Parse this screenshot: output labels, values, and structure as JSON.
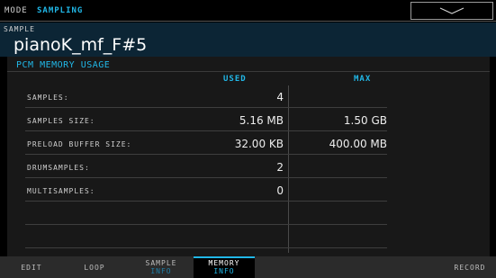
{
  "mode": {
    "label": "MODE",
    "value": "SAMPLING"
  },
  "sample": {
    "caption": "SAMPLE",
    "name": "pianoK_mf_F#5"
  },
  "panel": {
    "title": "PCM MEMORY USAGE",
    "headers": {
      "used": "USED",
      "max": "MAX"
    },
    "rows": [
      {
        "label": "SAMPLES:",
        "used": "4",
        "max": ""
      },
      {
        "label": "SAMPLES SIZE:",
        "used": "5.16 MB",
        "max": "1.50 GB"
      },
      {
        "label": "PRELOAD BUFFER SIZE:",
        "used": "32.00 KB",
        "max": "400.00 MB"
      },
      {
        "label": "DRUMSAMPLES:",
        "used": "2",
        "max": ""
      },
      {
        "label": "MULTISAMPLES:",
        "used": "0",
        "max": ""
      },
      {
        "label": "",
        "used": "",
        "max": ""
      },
      {
        "label": "",
        "used": "",
        "max": ""
      }
    ]
  },
  "tabs": [
    {
      "line1": "EDIT",
      "line2": ""
    },
    {
      "line1": "LOOP",
      "line2": ""
    },
    {
      "line1": "SAMPLE",
      "line2": "INFO"
    },
    {
      "line1": "MEMORY",
      "line2": "INFO"
    },
    {
      "line1": "RECORD",
      "line2": ""
    }
  ],
  "colors": {
    "accent": "#21b8e8",
    "header_bg": "#0c2535",
    "panel_bg": "#181818",
    "tab_bg": "#2b2b2b"
  },
  "icons": {
    "mode_dropdown": "chevron-down-icon"
  }
}
